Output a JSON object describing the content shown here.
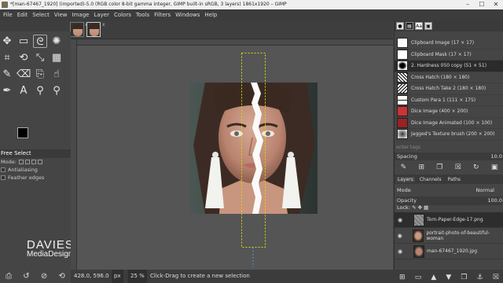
{
  "window": {
    "title": "*[man-67467_1920] (imported)-5.0 (RGB color 8-bit gamma integer, GIMP built-in sRGB, 3 layers) 1861x1920 – GIMP",
    "min": "–",
    "max": "☐",
    "close": "✕"
  },
  "menu": [
    "File",
    "Edit",
    "Select",
    "View",
    "Image",
    "Layer",
    "Colors",
    "Tools",
    "Filters",
    "Windows",
    "Help"
  ],
  "tabs": {
    "close": "x"
  },
  "tools": {
    "active_name": "Free Select",
    "mode_label": "Mode:",
    "antialiasing": "Antialiasing",
    "feather": "Feather edges"
  },
  "logo": {
    "line1": "DAVIES",
    "line2": "MediaDesign"
  },
  "status": {
    "coords": "428.0, 596.0",
    "unit": "px",
    "zoom": "25 %",
    "message": "Click-Drag to create a new selection"
  },
  "brushes": {
    "items": [
      "Clipboard Image (17 × 17)",
      "Clipboard Mask (17 × 17)",
      "2. Hardness 050 copy (51 × 51)",
      "Cross Hatch (180 × 180)",
      "Cross Hatch Take 2 (180 × 180)",
      "Custom Para 1 (111 × 175)",
      "Dice Image (400 × 200)",
      "Dice Image Animated (100 × 100)",
      "Jagged's Texture brush (200 × 200)"
    ],
    "selected_index": 2,
    "filter_placeholder": "enter tags",
    "spacing_label": "Spacing",
    "spacing_value": "10.0"
  },
  "dock": {
    "tabs": [
      "Layers",
      "Channels",
      "Paths"
    ],
    "mode_label": "Mode",
    "mode_value": "Normal",
    "opacity_label": "Opacity",
    "opacity_value": "100.0",
    "lock_label": "Lock:"
  },
  "layers": [
    {
      "name": "Torn-Paper-Edge-17.png",
      "selected": true
    },
    {
      "name": "portrait-photo-of-beautiful-woman",
      "selected": false
    },
    {
      "name": "man-67467_1920.jpg",
      "selected": false
    }
  ]
}
